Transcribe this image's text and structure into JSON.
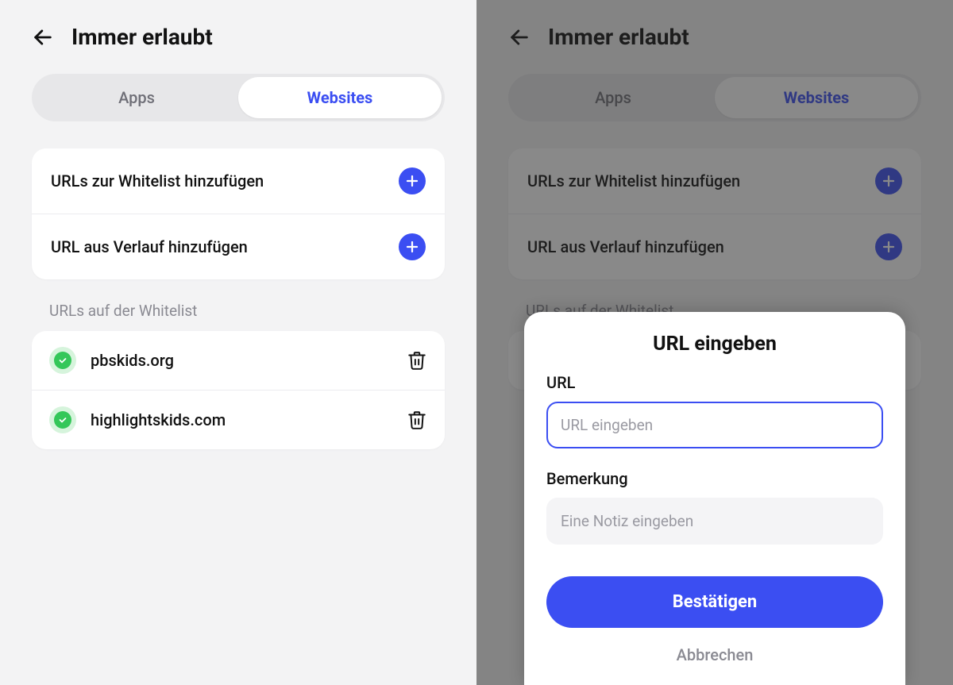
{
  "header": {
    "title": "Immer erlaubt"
  },
  "tabs": {
    "apps": "Apps",
    "websites": "Websites"
  },
  "actions": {
    "add_whitelist": "URLs zur Whitelist hinzufügen",
    "add_history": "URL aus Verlauf hinzufügen"
  },
  "whitelist": {
    "section_label": "URLs auf der Whitelist",
    "items": [
      {
        "url": "pbskids.org"
      },
      {
        "url": "highlightskids.com"
      }
    ]
  },
  "dialog": {
    "title": "URL eingeben",
    "url_label": "URL",
    "url_placeholder": "URL eingeben",
    "url_value": "",
    "note_label": "Bemerkung",
    "note_placeholder": "Eine Notiz eingeben",
    "note_value": "",
    "confirm": "Bestätigen",
    "cancel": "Abbrechen"
  }
}
